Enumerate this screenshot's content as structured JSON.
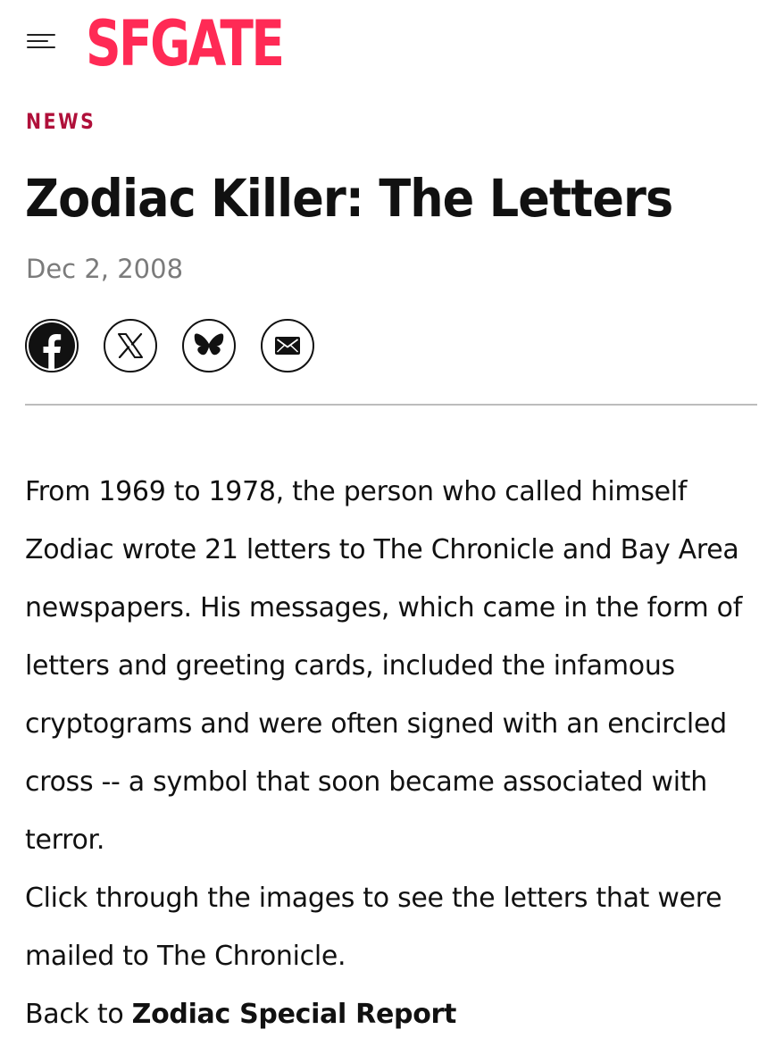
{
  "header": {
    "menu_icon": "hamburger-menu-icon",
    "logo_text": "SFGATE",
    "brand_color": "#ff2a55"
  },
  "article": {
    "section": "NEWS",
    "section_color": "#b0103a",
    "title": "Zodiac Killer: The Letters",
    "date": "Dec 2, 2008",
    "share_icons": [
      "facebook-icon",
      "x-icon",
      "bluesky-icon",
      "email-icon"
    ],
    "paragraph_1": "From 1969 to 1978, the person who called himself Zodiac wrote 21 letters to The Chronicle and Bay Area newspapers. His messages, which came in the form of letters and greeting cards, included the infamous cryptograms and were often signed with an encircled cross -- a symbol that soon became associated with terror.",
    "paragraph_2": "Click through the images to see the letters that were mailed to The Chronicle.",
    "back_prefix": "Back to ",
    "back_link": "Zodiac Special Report"
  }
}
